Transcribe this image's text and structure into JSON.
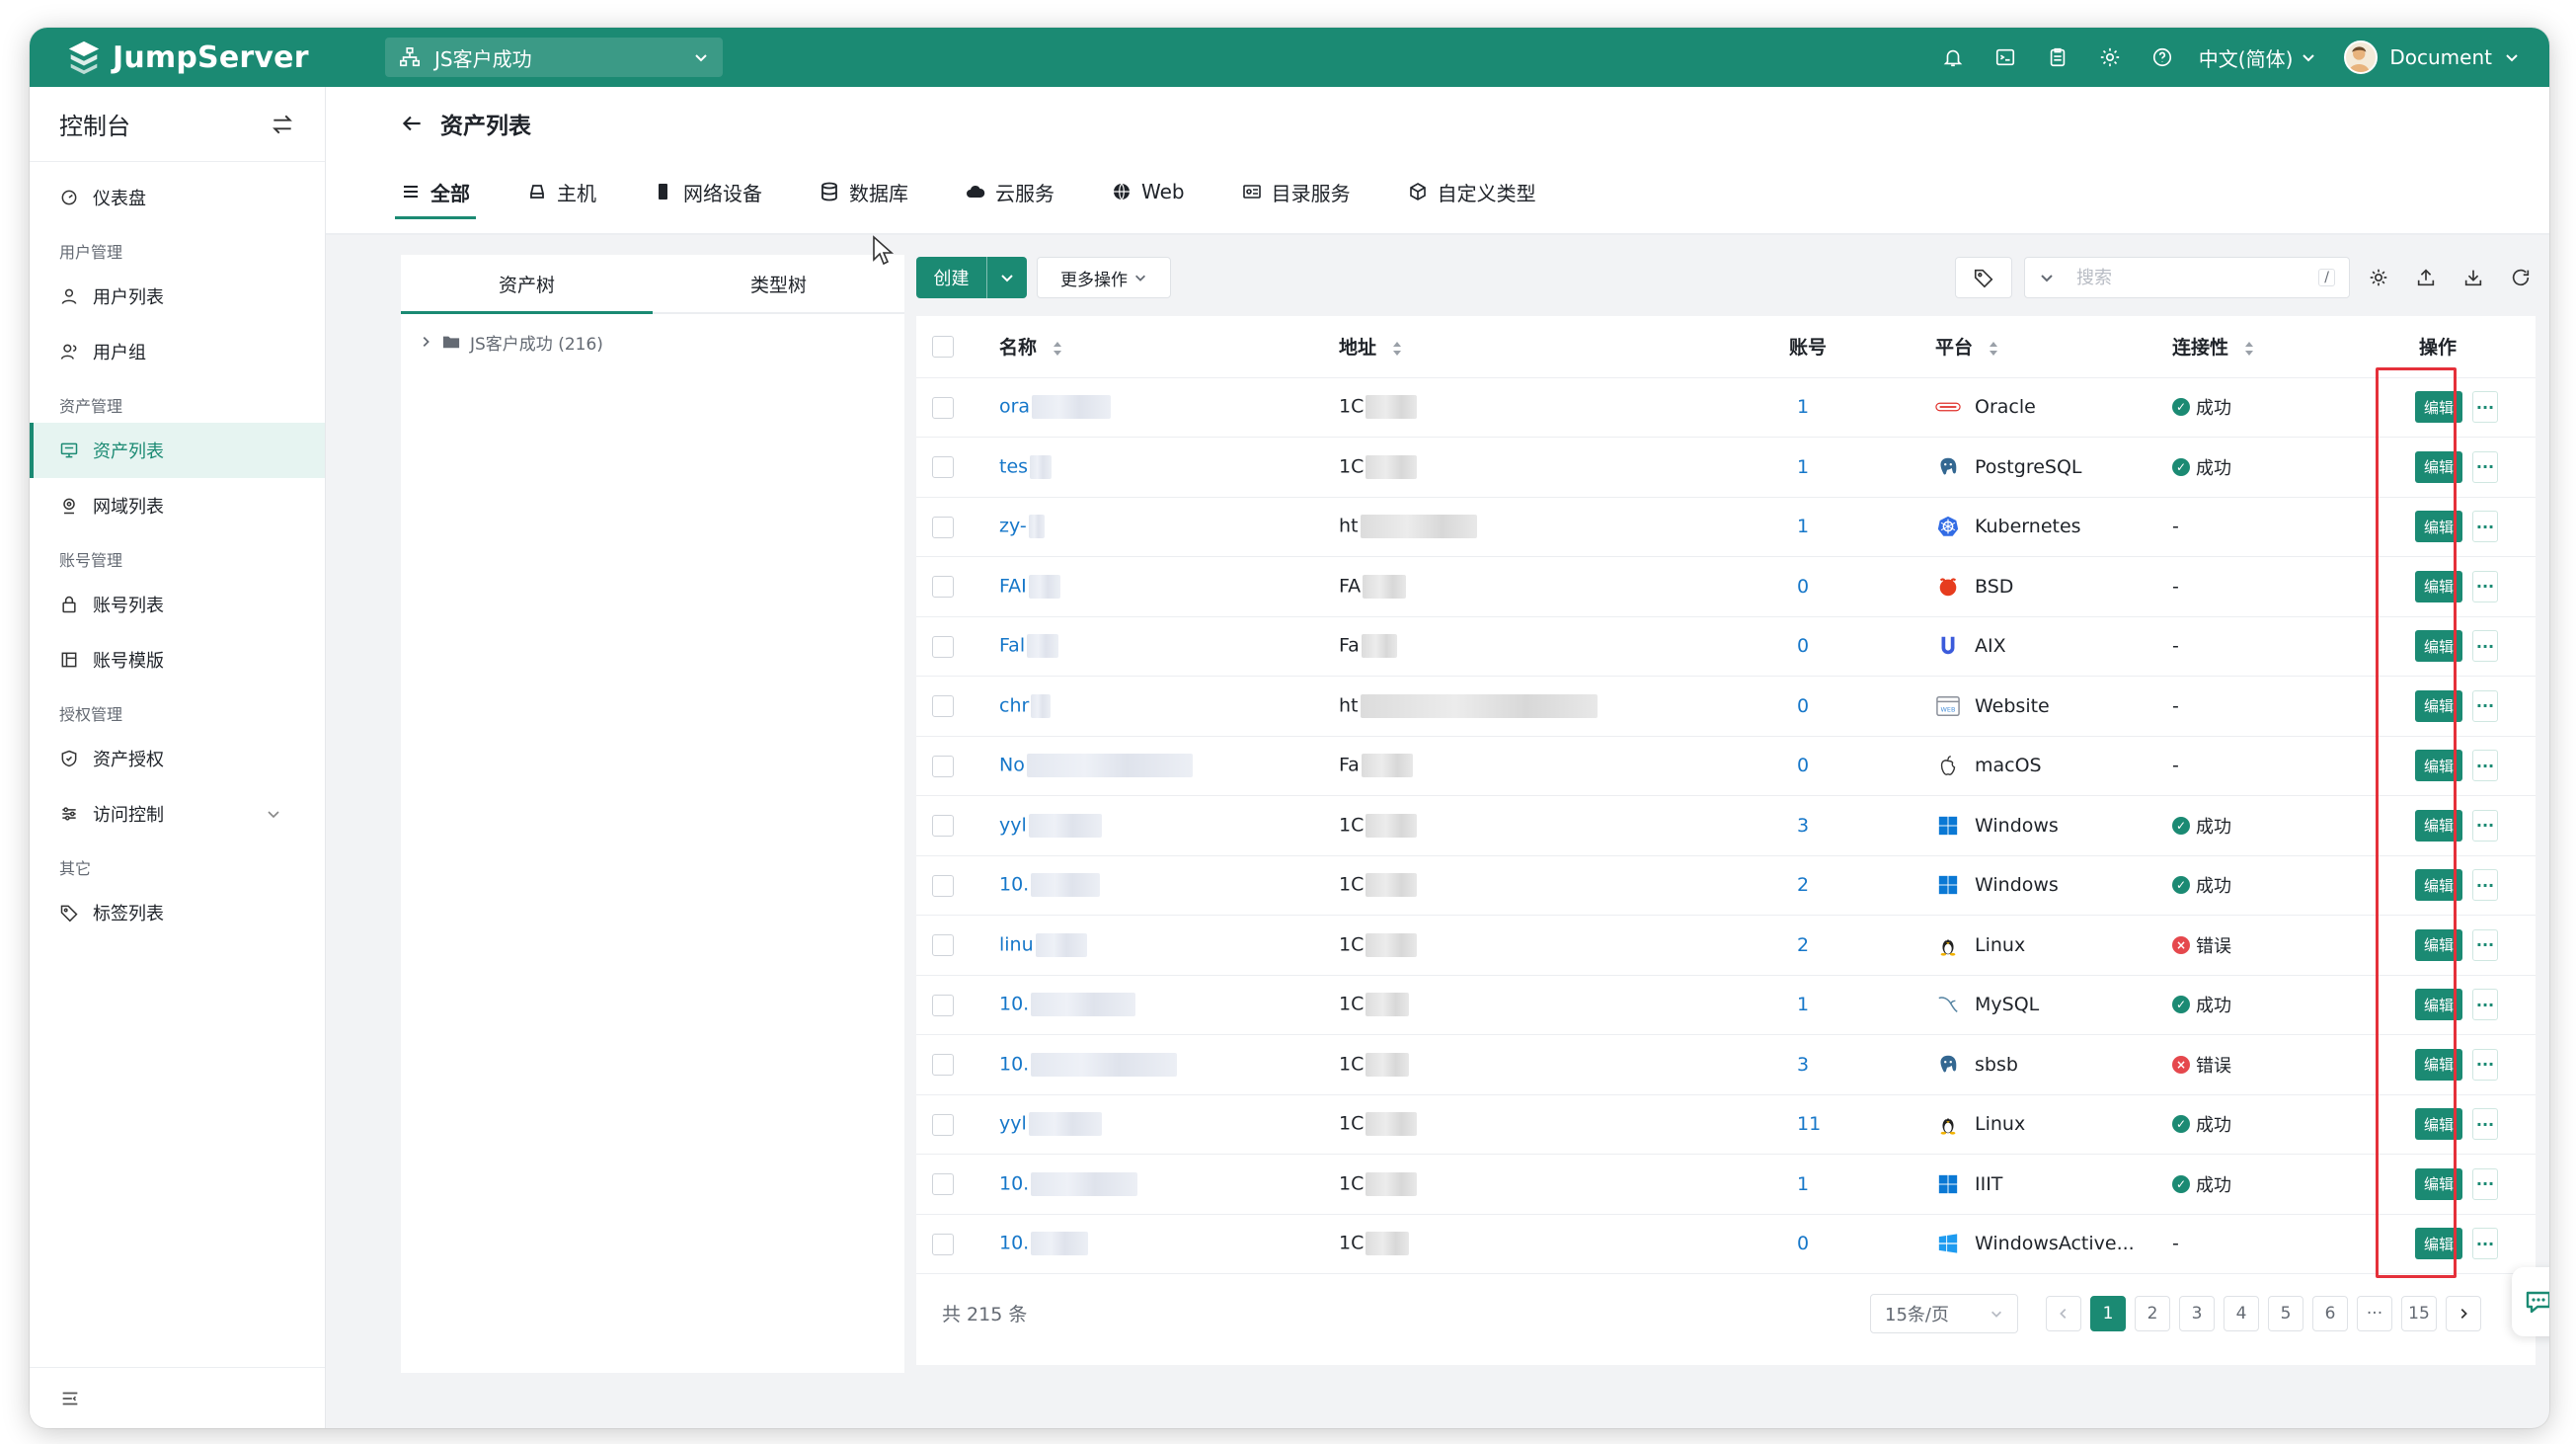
{
  "topbar": {
    "brand": "JumpServer",
    "org": "JS客户成功",
    "language": "中文(简体)",
    "user": "Document",
    "icons": [
      "bell-icon",
      "terminal-icon",
      "clipboard-icon",
      "gear-icon",
      "help-icon"
    ]
  },
  "sidebar": {
    "title": "控制台",
    "dashboard": "仪表盘",
    "groups": {
      "users": "用户管理",
      "assets": "资产管理",
      "accounts": "账号管理",
      "perms": "授权管理",
      "other": "其它"
    },
    "items": {
      "user_list": "用户列表",
      "user_group": "用户组",
      "asset_list": "资产列表",
      "zone_list": "网域列表",
      "account_list": "账号列表",
      "account_template": "账号模版",
      "asset_perm": "资产授权",
      "access_control": "访问控制",
      "label_list": "标签列表"
    }
  },
  "page": {
    "title": "资产列表",
    "tabs": [
      "全部",
      "主机",
      "网络设备",
      "数据库",
      "云服务",
      "Web",
      "目录服务",
      "自定义类型"
    ]
  },
  "tree": {
    "tabs": [
      "资产树",
      "类型树"
    ],
    "root": "JS客户成功 (216)"
  },
  "toolbar": {
    "create": "创建",
    "more_actions": "更多操作",
    "search_placeholder": "搜索",
    "search_hotkey": "/"
  },
  "table": {
    "columns": {
      "name": "名称",
      "address": "地址",
      "accounts": "账号",
      "platform": "平台",
      "connectivity": "连接性",
      "actions": "操作"
    },
    "edit_label": "编辑",
    "more_label": "···",
    "rows": [
      {
        "name": "ora",
        "address": "1C",
        "accounts": "1",
        "platform": "Oracle",
        "platform_icon": "oracle-icon",
        "conn": "成功",
        "conn_state": "ok"
      },
      {
        "name": "tes",
        "address": "1C",
        "accounts": "1",
        "platform": "PostgreSQL",
        "platform_icon": "postgresql-icon",
        "conn": "成功",
        "conn_state": "ok"
      },
      {
        "name": "zy-",
        "address": "ht",
        "accounts": "1",
        "platform": "Kubernetes",
        "platform_icon": "kubernetes-icon",
        "conn": "-",
        "conn_state": "none"
      },
      {
        "name": "FAI",
        "address": "FA",
        "accounts": "0",
        "platform": "BSD",
        "platform_icon": "bsd-icon",
        "conn": "-",
        "conn_state": "none"
      },
      {
        "name": "Fal",
        "address": "Fa",
        "accounts": "0",
        "platform": "AIX",
        "platform_icon": "aix-icon",
        "conn": "-",
        "conn_state": "none"
      },
      {
        "name": "chr",
        "address": "ht",
        "accounts": "0",
        "platform": "Website",
        "platform_icon": "website-icon",
        "conn": "-",
        "conn_state": "none"
      },
      {
        "name": "No",
        "address": "Fa",
        "accounts": "0",
        "platform": "macOS",
        "platform_icon": "apple-icon",
        "conn": "-",
        "conn_state": "none"
      },
      {
        "name": "yyl",
        "address": "1C",
        "accounts": "3",
        "platform": "Windows",
        "platform_icon": "windows-icon",
        "conn": "成功",
        "conn_state": "ok"
      },
      {
        "name": "10.",
        "address": "1C",
        "accounts": "2",
        "platform": "Windows",
        "platform_icon": "windows-icon",
        "conn": "成功",
        "conn_state": "ok"
      },
      {
        "name": "linu",
        "address": "1C",
        "accounts": "2",
        "platform": "Linux",
        "platform_icon": "linux-icon",
        "conn": "错误",
        "conn_state": "err"
      },
      {
        "name": "10.",
        "address": "1C",
        "accounts": "1",
        "platform": "MySQL",
        "platform_icon": "mysql-icon",
        "conn": "成功",
        "conn_state": "ok"
      },
      {
        "name": "10.",
        "address": "1C",
        "accounts": "3",
        "platform": "sbsb",
        "platform_icon": "postgresql-icon",
        "conn": "错误",
        "conn_state": "err"
      },
      {
        "name": "yyl",
        "address": "1C",
        "accounts": "11",
        "platform": "Linux",
        "platform_icon": "linux-icon",
        "conn": "成功",
        "conn_state": "ok"
      },
      {
        "name": "10.",
        "address": "1C",
        "accounts": "1",
        "platform": "IIIT",
        "platform_icon": "windows-icon",
        "conn": "成功",
        "conn_state": "ok"
      },
      {
        "name": "10.",
        "address": "1C",
        "accounts": "0",
        "platform": "WindowsActive...",
        "platform_icon": "windows-active-icon",
        "conn": "-",
        "conn_state": "none"
      }
    ]
  },
  "pager": {
    "total": "共 215 条",
    "page_size": "15条/页",
    "pages": [
      "1",
      "2",
      "3",
      "4",
      "5",
      "6",
      "···",
      "15"
    ],
    "current": "1"
  },
  "colors": {
    "brand": "#1b8a73",
    "link": "#1677c9",
    "error": "#e5484d",
    "highlight": "#e5303a"
  }
}
